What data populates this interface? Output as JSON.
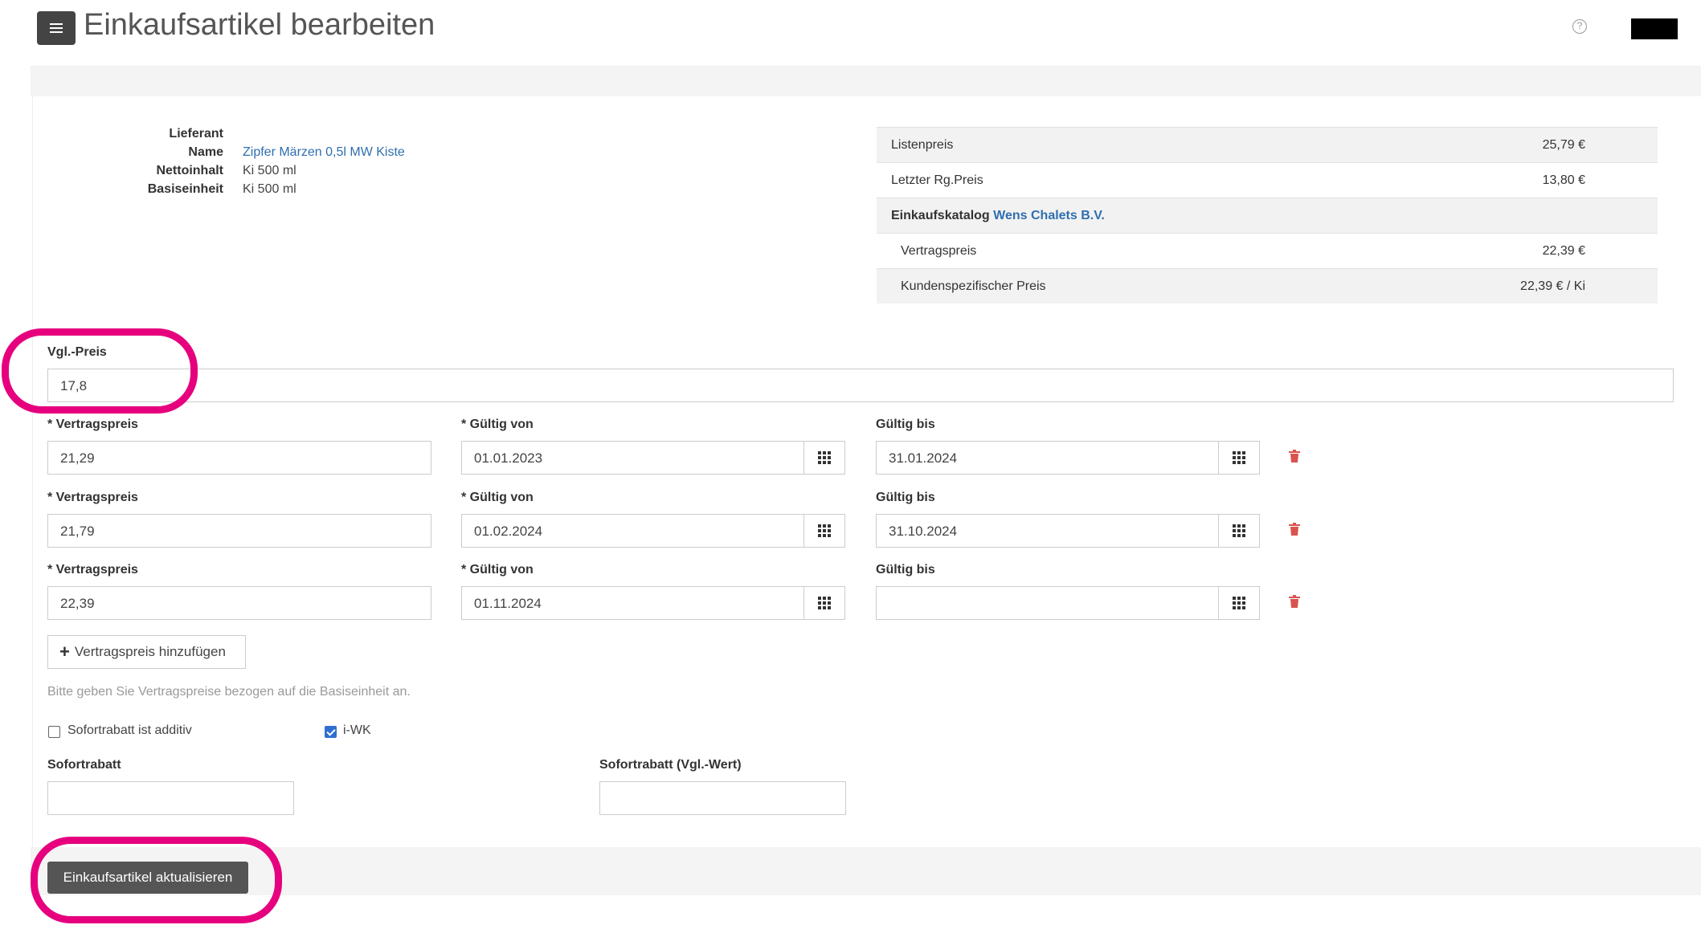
{
  "header": {
    "title": "Einkaufsartikel bearbeiten",
    "help_symbol": "?"
  },
  "article_info": [
    {
      "label": "Lieferant",
      "value": ""
    },
    {
      "label": "Name",
      "value": "Zipfer Märzen 0,5l MW Kiste",
      "link": true
    },
    {
      "label": "Nettoinhalt",
      "value": "Ki 500 ml"
    },
    {
      "label": "Basiseinheit",
      "value": "Ki 500 ml"
    }
  ],
  "price_table": {
    "listenpreis_label": "Listenpreis",
    "listenpreis_value": "25,79 €",
    "letzter_label": "Letzter Rg.Preis",
    "letzter_value": "13,80 €",
    "katalog_label": "Einkaufskatalog",
    "katalog_name": "Wens Chalets B.V.",
    "vertragspreis_label": "Vertragspreis",
    "vertragspreis_value": "22,39 €",
    "kunden_label": "Kundenspezifischer Preis",
    "kunden_value": "22,39 € / Ki"
  },
  "vgl_preis": {
    "label": "Vgl.-Preis",
    "value": "17,8"
  },
  "contract_rows": [
    {
      "price_label": "* Vertragspreis",
      "price": "21,29",
      "from_label": "* Gültig von",
      "from": "01.01.2023",
      "to_label": "Gültig bis",
      "to": "31.01.2024"
    },
    {
      "price_label": "* Vertragspreis",
      "price": "21,79",
      "from_label": "* Gültig von",
      "from": "01.02.2024",
      "to_label": "Gültig bis",
      "to": "31.10.2024"
    },
    {
      "price_label": "* Vertragspreis",
      "price": "22,39",
      "from_label": "* Gültig von",
      "from": "01.11.2024",
      "to_label": "Gültig bis",
      "to": ""
    }
  ],
  "add_button": {
    "label": "Vertragspreis hinzufügen"
  },
  "hint": "Bitte geben Sie Vertragspreise bezogen auf die Basiseinheit an.",
  "checkboxes": {
    "sofortrabatt_additiv": {
      "label": "Sofortrabatt ist additiv",
      "checked": false
    },
    "iwk": {
      "label": "i-WK",
      "checked": true
    }
  },
  "sofortrabatt": {
    "label": "Sofortrabatt",
    "value": ""
  },
  "sofortrabatt_vgl": {
    "label": "Sofortrabatt (Vgl.-Wert)",
    "value": ""
  },
  "submit": {
    "label": "Einkaufsartikel aktualisieren"
  },
  "colors": {
    "highlight": "#e6007e",
    "link": "#2f6fb0",
    "trash": "#d9534f",
    "checkbox": "#2f6fd0"
  }
}
